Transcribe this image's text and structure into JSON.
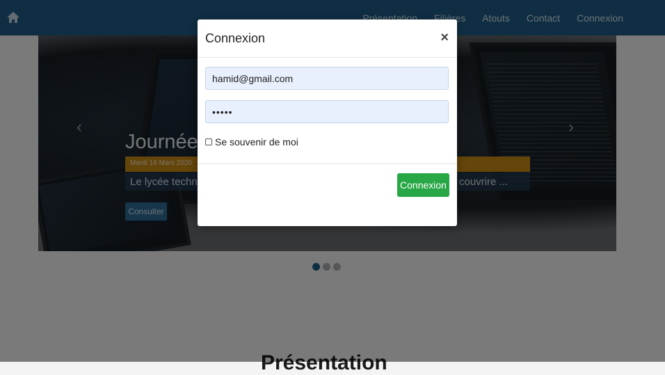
{
  "navbar": {
    "links": [
      "Présentation",
      "Filières",
      "Atouts",
      "Contact",
      "Connexion"
    ]
  },
  "carousel": {
    "title": "Journées",
    "date": "Mardi 16 Mars 2020",
    "text_start": "Le lycée techni",
    "text_end": "couvrire ...",
    "button_label": "Consulter",
    "prev_icon": "chevron-left-icon",
    "next_icon": "chevron-right-icon",
    "active_slide": 1,
    "slide_count": 3
  },
  "section": {
    "title": "Présentation"
  },
  "modal": {
    "title": "Connexion",
    "close_label": "×",
    "email_value": "hamid@gmail.com",
    "password_value": "•••••",
    "remember_label": "Se souvenir de moi",
    "submit_label": "Connexion"
  },
  "colors": {
    "navbar": "#1f5d86",
    "submit": "#27a745",
    "date_bar": "#c98a14"
  }
}
